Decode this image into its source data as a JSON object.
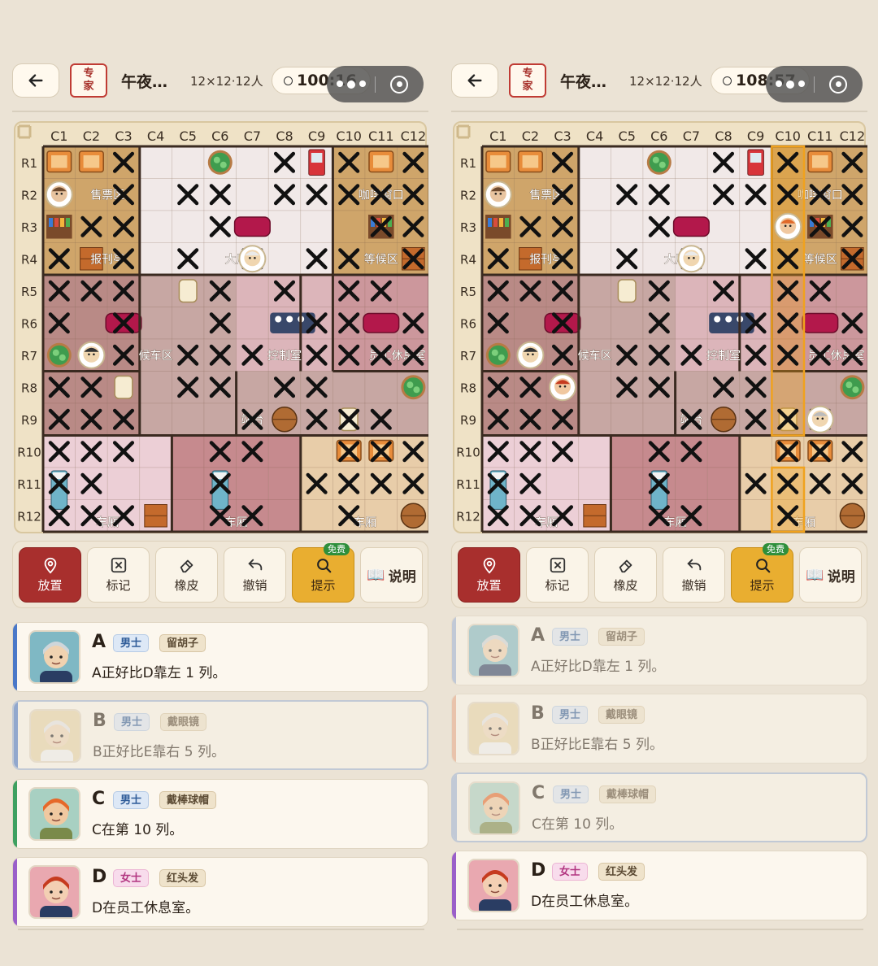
{
  "panels": [
    {
      "header": {
        "badge": "专\n家",
        "title": "午夜…",
        "size": "12×12·12人",
        "timer": "100:16"
      },
      "board": {
        "col_labels": [
          "C1",
          "C2",
          "C3",
          "C4",
          "C5",
          "C6",
          "C7",
          "C8",
          "C9",
          "C10",
          "C11",
          "C12"
        ],
        "row_labels": [
          "R1",
          "R2",
          "R3",
          "R4",
          "R5",
          "R6",
          "R7",
          "R8",
          "R9",
          "R10",
          "R11",
          "R12"
        ],
        "room_labels": [
          "售票区",
          "咖啡窗口",
          "报刊亭",
          "大厅",
          "等候区",
          "候车区",
          "控制室",
          "员工休息室",
          "站台",
          "车厢",
          "车厢",
          "车厢"
        ],
        "highlight_column": null
      },
      "toolbar": {
        "place": "放置",
        "mark": "标记",
        "erase": "橡皮",
        "undo": "撤销",
        "hint": "提示",
        "free": "免费",
        "help": "说明"
      },
      "cards": [
        {
          "label": "A",
          "gender": "男士",
          "trait": "留胡子",
          "desc": "A正好比D靠左 1 列。",
          "state": "normal",
          "color": "#4a78c8"
        },
        {
          "label": "B",
          "gender": "男士",
          "trait": "戴眼镜",
          "desc": "B正好比E靠右 5 列。",
          "state": "dim-selected",
          "color": "#4a78c8"
        },
        {
          "label": "C",
          "gender": "男士",
          "trait": "戴棒球帽",
          "desc": "C在第 10 列。",
          "state": "normal",
          "color": "#3ea060"
        },
        {
          "label": "D",
          "gender": "女士",
          "trait": "红头发",
          "desc": "D在员工休息室。",
          "state": "normal",
          "color": "#9a5fc9"
        }
      ]
    },
    {
      "header": {
        "badge": "专\n家",
        "title": "午夜…",
        "size": "12×12·12人",
        "timer": "108:57"
      },
      "board": {
        "col_labels": [
          "C1",
          "C2",
          "C3",
          "C4",
          "C5",
          "C6",
          "C7",
          "C8",
          "C9",
          "C10",
          "C11",
          "C12"
        ],
        "row_labels": [
          "R1",
          "R2",
          "R3",
          "R4",
          "R5",
          "R6",
          "R7",
          "R8",
          "R9",
          "R10",
          "R11",
          "R12"
        ],
        "room_labels": [
          "售票区",
          "咖啡窗口",
          "报刊亭",
          "大厅",
          "等候区",
          "候车区",
          "控制室",
          "员工休息室",
          "站台",
          "车厢",
          "车厢",
          "车厢"
        ],
        "highlight_column": "C10"
      },
      "toolbar": {
        "place": "放置",
        "mark": "标记",
        "erase": "橡皮",
        "undo": "撤销",
        "hint": "提示",
        "free": "免费",
        "help": "说明"
      },
      "cards": [
        {
          "label": "A",
          "gender": "男士",
          "trait": "留胡子",
          "desc": "A正好比D靠左 1 列。",
          "state": "dim",
          "color": "#9fb4d8"
        },
        {
          "label": "B",
          "gender": "男士",
          "trait": "戴眼镜",
          "desc": "B正好比E靠右 5 列。",
          "state": "dim",
          "color": "#e9a98a"
        },
        {
          "label": "C",
          "gender": "男士",
          "trait": "戴棒球帽",
          "desc": "C在第 10 列。",
          "state": "dim-selected",
          "color": "#9fb4d8"
        },
        {
          "label": "D",
          "gender": "女士",
          "trait": "红头发",
          "desc": "D在员工休息室。",
          "state": "normal",
          "color": "#9a5fc9"
        }
      ]
    }
  ],
  "colors": {
    "primary": "#a82f2d",
    "hint": "#e9ae30",
    "highlight": "#f0a21e"
  }
}
